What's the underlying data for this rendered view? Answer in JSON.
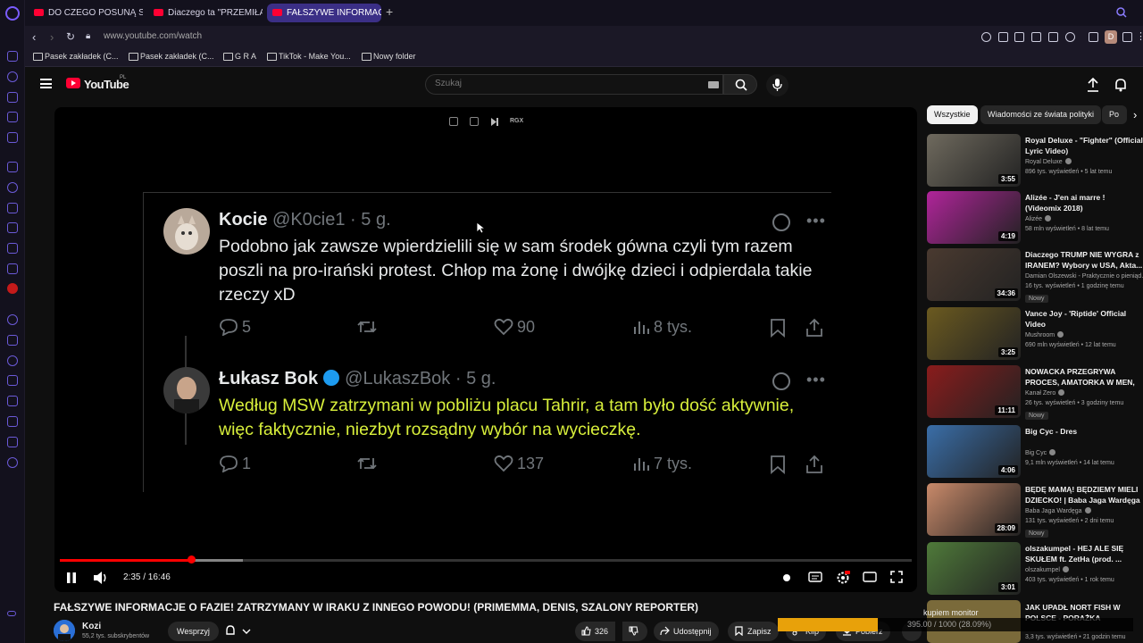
{
  "browser": {
    "tabs": [
      {
        "label": "DO CZEGO POSUNĄ SIĘ K"
      },
      {
        "label": "Diaczego ta \"PRZEMIŁA\""
      },
      {
        "label": "FAŁSZYWE INFORMAC"
      }
    ],
    "url": "www.youtube.com/watch",
    "profile_letter": "D",
    "bookmarks": [
      "Pasek zakładek (C...",
      "Pasek zakładek (C...",
      "G R A",
      "TikTok - Make You...",
      "Nowy folder"
    ]
  },
  "youtube": {
    "logo_text": "YouTube",
    "region": "PL",
    "search_placeholder": "Szukaj"
  },
  "player": {
    "rgx_label": "RGX",
    "time_label": "2:35 / 16:46",
    "progress": 0.1545,
    "buffered": 0.215,
    "tweets": [
      {
        "name": "Kocie",
        "handle": "@K0cie1 · 5 g.",
        "text": "Podobno jak zawsze wpierdzielili się w sam środek gówna czyli tym razem poszli na pro-irański protest. Chłop ma żonę i dwójkę dzieci i odpierdala takie rzeczy xD",
        "replies": "5",
        "likes": "90",
        "views": "8 tys."
      },
      {
        "name": "Łukasz Bok",
        "handle": "@LukaszBok · 5 g.",
        "text": "Według MSW zatrzymani w pobliżu placu Tahrir, a tam było dość aktywnie, więc faktycznie, niezbyt rozsądny wybór na wycieczkę.",
        "replies": "1",
        "likes": "137",
        "views": "7 tys."
      }
    ]
  },
  "chips": [
    "Wszystkie",
    "Wiadomości ze świata polityki",
    "Po"
  ],
  "recommendations": [
    {
      "title": "Royal Deluxe - \"Fighter\" (Official Lyric Video)",
      "channel": "Royal Deluxe",
      "meta": "896 tys. wyświetleń • 5 lat temu",
      "duration": "3:55",
      "badge": "",
      "thumb_color": "#6f6a5e"
    },
    {
      "title": "Alizée - J'en ai marre ! (Videomix 2018)",
      "channel": "Alizée",
      "meta": "58 mln wyświetleń • 8 lat temu",
      "duration": "4:19",
      "badge": "",
      "thumb_color": "#b0249a"
    },
    {
      "title": "Diaczego TRUMP NIE WYGRA z IRANEM? Wybory w USA, Akta...",
      "channel": "Damian Olszewski - Praktycznie o pieniąd...",
      "meta": "16 tys. wyświetleń • 1 godzinę temu",
      "duration": "34:36",
      "badge": "Nowy",
      "thumb_color": "#4a3a30"
    },
    {
      "title": "Vance Joy - 'Riptide' Official Video",
      "channel": "Mushroom",
      "meta": "690 mln wyświetleń • 12 lat temu",
      "duration": "3:25",
      "badge": "",
      "thumb_color": "#6b5a20"
    },
    {
      "title": "NOWACKA PRZEGRYWA PROCES, AMATORKA W MEN, ...",
      "channel": "Kanał Zero",
      "meta": "26 tys. wyświetleń • 3 godziny temu",
      "duration": "11:11",
      "badge": "Nowy",
      "thumb_color": "#8a1c1c"
    },
    {
      "title": "Big Cyc - Dres",
      "channel": "Big Cyc",
      "meta": "9,1 mln wyświetleń • 14 lat temu",
      "duration": "4:06",
      "badge": "",
      "thumb_color": "#3a6ea8"
    },
    {
      "title": "BĘDĘ MAMĄ! BĘDZIEMY MIELI DZIECKO! | Baba Jaga Wardęga",
      "channel": "Baba Jaga Wardęga",
      "meta": "131 tys. wyświetleń • 2 dni temu",
      "duration": "28:09",
      "badge": "Nowy",
      "thumb_color": "#c98a6a"
    },
    {
      "title": "olszakumpel - HEJ ALE SIĘ SKUŁEM ft. ZetHa (prod. ...",
      "channel": "olszakumpel",
      "meta": "403 tys. wyświetleń • 1 rok temu",
      "duration": "3:01",
      "badge": "",
      "thumb_color": "#4f7a3a"
    },
    {
      "title": "JAK UPADŁ NORT FISH W POLSCE - PORAŻKA",
      "channel": "",
      "meta": "3,3 tys. wyświetleń • 21 godzin temu",
      "duration": "",
      "badge": "",
      "thumb_color": "#7a6a3a"
    }
  ],
  "video": {
    "title": "FAŁSZYWE INFORMACJE O FAZIE! ZATRZYMANY W IRAKU Z INNEGO POWODU! (PRIMEMMA, DENIS, SZALONY REPORTER)",
    "channel": "Kozi",
    "subscribers": "55,2 tys. subskrybentów",
    "support_label": "Wesprzyj",
    "likes": "326",
    "share_label": "Udostępnij",
    "save_label": "Zapisz",
    "clip_label": "Klip",
    "download_label": "Pobierz"
  },
  "download_overlay": {
    "label": "kupiem monitor",
    "text": "395.00 / 1000 (28.09%)",
    "progress": 0.2809
  }
}
